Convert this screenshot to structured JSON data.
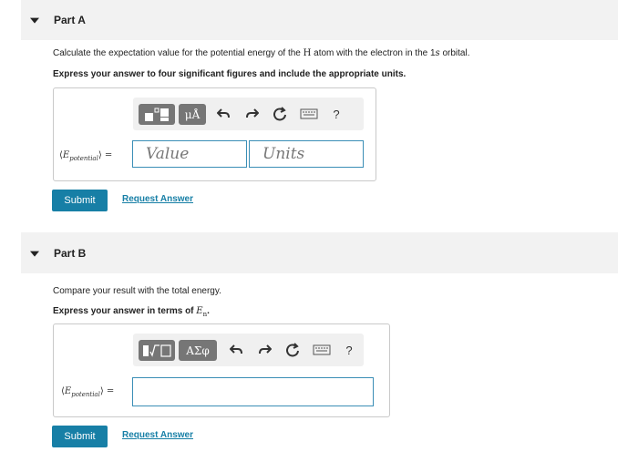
{
  "part_a": {
    "title": "Part A",
    "instruction_pre": "Calculate the expectation value for the potential energy of the ",
    "instruction_h": "H",
    "instruction_mid": " atom with the electron in the 1",
    "instruction_s": "s",
    "instruction_post": " orbital.",
    "express": "Express your answer to four significant figures and include the appropriate units.",
    "toolbar": {
      "btn2": "μÅ",
      "help": "?"
    },
    "answer_label_e": "E",
    "answer_label_sub": "potential",
    "value_placeholder": "Value",
    "units_placeholder": "Units",
    "submit": "Submit",
    "request": "Request Answer"
  },
  "part_b": {
    "title": "Part B",
    "instruction": "Compare your result with the total energy.",
    "express_pre": "Express your answer in terms of ",
    "express_e": "E",
    "express_sub": "n",
    "express_post": ".",
    "toolbar": {
      "btn2": "ΑΣφ",
      "help": "?"
    },
    "answer_label_e": "E",
    "answer_label_sub": "potential",
    "submit": "Submit",
    "request": "Request Answer"
  },
  "colors": {
    "accent": "#177fa6",
    "toolbar_button": "#767676",
    "field_border": "#3a8eb6",
    "header_bg": "#f2f2f2"
  }
}
